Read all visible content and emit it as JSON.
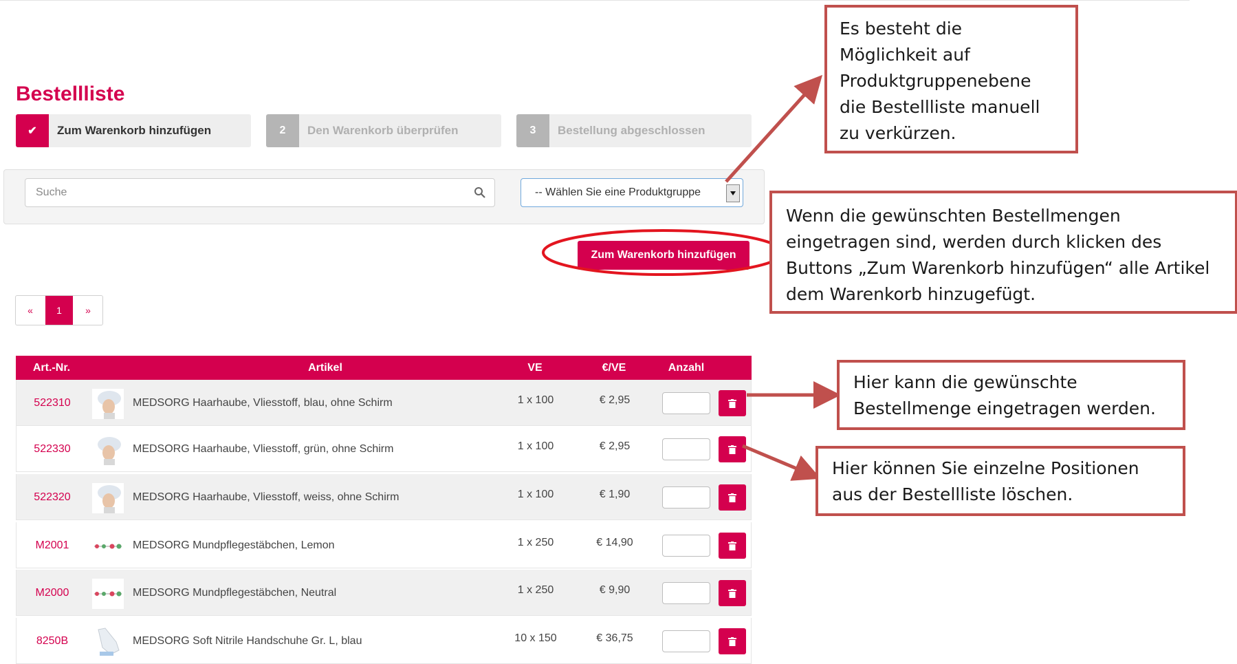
{
  "page": {
    "title": "Bestellliste"
  },
  "steps": [
    {
      "num": "✔",
      "label": "Zum Warenkorb hinzufügen",
      "state": "active"
    },
    {
      "num": "2",
      "label": "Den Warenkorb überprüfen",
      "state": "inactive"
    },
    {
      "num": "3",
      "label": "Bestellung abgeschlossen",
      "state": "inactive"
    }
  ],
  "filters": {
    "search_placeholder": "Suche",
    "product_group_selected": "-- Wählen Sie eine Produktgruppe"
  },
  "actions": {
    "add_to_cart": "Zum Warenkorb hinzufügen"
  },
  "pagination": {
    "prev": "«",
    "current": "1",
    "next": "»"
  },
  "table": {
    "headers": {
      "artnr": "Art.-Nr.",
      "artikel": "Artikel",
      "ve": "VE",
      "price": "€/VE",
      "qty": "Anzahl"
    },
    "rows": [
      {
        "artnr": "522310",
        "name": "MEDSORG Haarhaube, Vliesstoff, blau, ohne Schirm",
        "ve": "1 x 100",
        "price": "€ 2,95",
        "thumb": "cap"
      },
      {
        "artnr": "522330",
        "name": "MEDSORG Haarhaube, Vliesstoff, grün, ohne Schirm",
        "ve": "1 x 100",
        "price": "€ 2,95",
        "thumb": "cap"
      },
      {
        "artnr": "522320",
        "name": "MEDSORG Haarhaube, Vliesstoff, weiss, ohne Schirm",
        "ve": "1 x 100",
        "price": "€ 1,90",
        "thumb": "cap"
      },
      {
        "artnr": "M2001",
        "name": "MEDSORG Mundpflegestäbchen, Lemon",
        "ve": "1 x 250",
        "price": "€ 14,90",
        "thumb": "swabs"
      },
      {
        "artnr": "M2000",
        "name": "MEDSORG Mundpflegestäbchen, Neutral",
        "ve": "1 x 250",
        "price": "€ 9,90",
        "thumb": "swabs"
      },
      {
        "artnr": "8250B",
        "name": "MEDSORG Soft Nitrile Handschuhe Gr. L, blau",
        "ve": "10 x 150",
        "price": "€ 36,75",
        "thumb": "glove"
      }
    ]
  },
  "callouts": {
    "product_group": "Es besteht die\nMöglichkeit auf\nProduktgruppenebene\ndie Bestellliste manuell\nzu verkürzen.",
    "add_to_cart": "Wenn die gewünschten Bestellmengen\neingetragen sind, werden durch klicken des\nButtons „Zum Warenkorb hinzufügen“ alle Artikel\ndem Warenkorb hinzugefügt.",
    "quantity": "Hier kann die gewünschte\nBestellmenge eingetragen werden.",
    "delete": "Hier können Sie einzelne Positionen\naus der Bestellliste löschen."
  },
  "colors": {
    "brand": "#d4004e",
    "callout_border": "#c0504d",
    "step_inactive_num": "#b5b5b5",
    "step_inactive_text": "#b0b0b0"
  }
}
